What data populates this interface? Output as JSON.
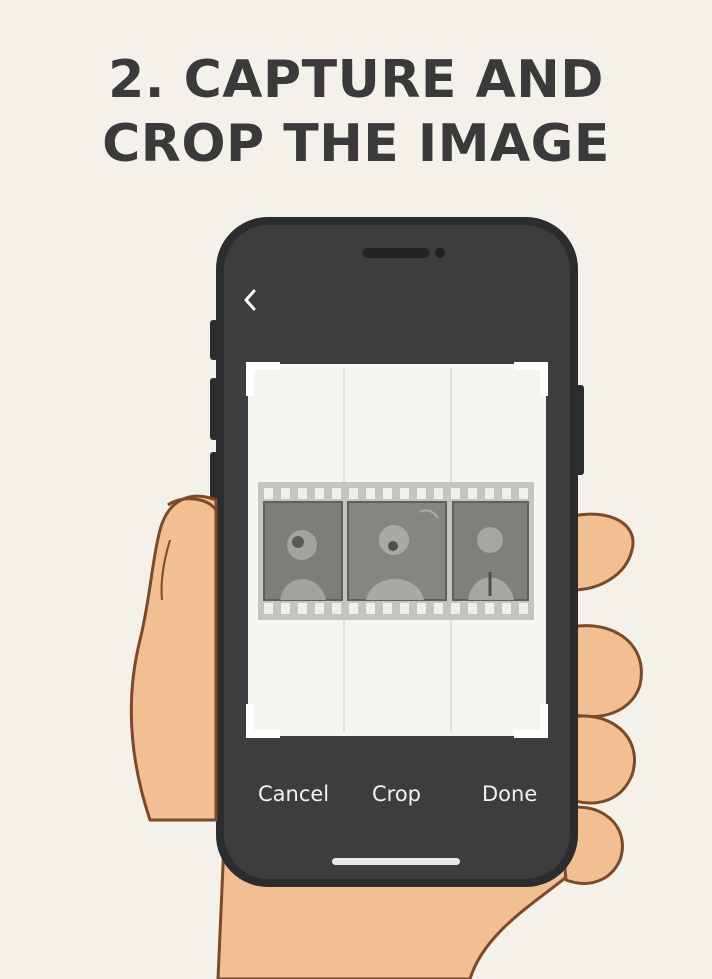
{
  "title": {
    "line1": "2. CAPTURE AND",
    "line2": "CROP THE IMAGE"
  },
  "phone": {
    "body_color": "#3b3d3e",
    "frame_color": "#2a2c2d",
    "back_icon": "chevron-left-icon"
  },
  "crop_area": {
    "page_color": "#f7f5ef",
    "handle_color": "#ffffff",
    "frames": 3,
    "film_color": "#c6c4be"
  },
  "actions": {
    "cancel_label": "Cancel",
    "crop_label": "Crop",
    "done_label": "Done"
  },
  "hand": {
    "skin_color": "#f2bf93",
    "outline_color": "#7a4a2a"
  }
}
